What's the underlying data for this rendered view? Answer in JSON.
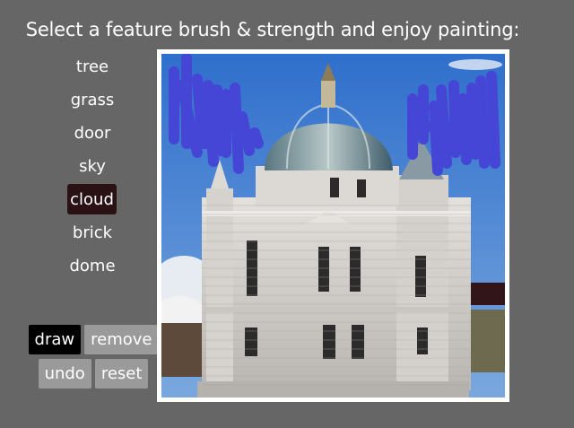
{
  "instructions": "Select a feature brush & strength and enjoy painting:",
  "features": [
    {
      "label": "tree",
      "name": "feature-tree"
    },
    {
      "label": "grass",
      "name": "feature-grass"
    },
    {
      "label": "door",
      "name": "feature-door"
    },
    {
      "label": "sky",
      "name": "feature-sky"
    },
    {
      "label": "cloud",
      "name": "feature-cloud"
    },
    {
      "label": "brick",
      "name": "feature-brick"
    },
    {
      "label": "dome",
      "name": "feature-dome"
    }
  ],
  "selected_feature": "cloud",
  "tools": {
    "draw_label": "draw",
    "remove_label": "remove",
    "undo_label": "undo",
    "reset_label": "reset",
    "active_tool": "draw"
  },
  "colors": {
    "background": "#666666",
    "selected_feature_bg": "#2a1214",
    "active_tool_bg": "#000000",
    "tool_bg": "#9a9a9a",
    "brush_stroke": "#4545d6",
    "sky": "#3b7cd8",
    "building": "#d8d4cf",
    "dome": "#6c8592",
    "canvas_border": "#ffffff"
  }
}
